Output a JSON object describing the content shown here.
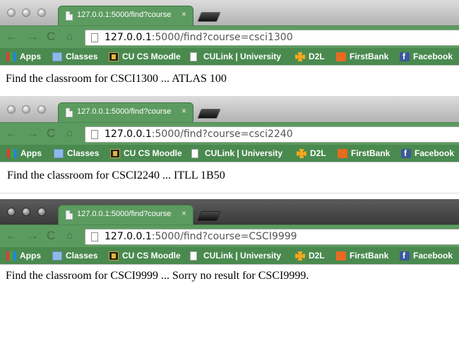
{
  "windows": [
    {
      "tab_title": "127.0.0.1:5000/find?course",
      "tab_close": "×",
      "url_host": "127.0.0.1",
      "url_rest": ":5000/find?course=csci1300",
      "result_text": "Find the classroom for CSCI1300 ... ATLAS 100"
    },
    {
      "tab_title": "127.0.0.1:5000/find?course",
      "tab_close": "×",
      "url_host": "127.0.0.1",
      "url_rest": ":5000/find?course=csci2240",
      "result_text": "Find the classroom for CSCI2240 ... ITLL 1B50"
    },
    {
      "tab_title": "127.0.0.1:5000/find?course",
      "tab_close": "×",
      "url_host": "127.0.0.1",
      "url_rest": ":5000/find?course=CSCI9999",
      "result_text": "Find the classroom for CSCI9999 ... Sorry no result for CSCI9999."
    }
  ],
  "nav": {
    "back": "←",
    "forward": "→",
    "reload": "C",
    "home": "⌂"
  },
  "bookmarks": [
    {
      "label": "Apps",
      "icon": "apps-grid-icon"
    },
    {
      "label": "Classes",
      "icon": "folder-icon"
    },
    {
      "label": "CU CS Moodle",
      "icon": "cu-logo-icon"
    },
    {
      "label": "CULink | University o",
      "icon": "page-icon"
    },
    {
      "label": "D2L",
      "icon": "d2l-icon"
    },
    {
      "label": "FirstBank",
      "icon": "firstbank-icon"
    },
    {
      "label": "Facebook",
      "icon": "facebook-icon"
    }
  ],
  "colors": {
    "theme_green": "#5c9b5f",
    "bookmarks_green": "#4a8a4f",
    "titlebar_active": "#b2b2b2",
    "titlebar_inactive": "#3a3a3a"
  }
}
